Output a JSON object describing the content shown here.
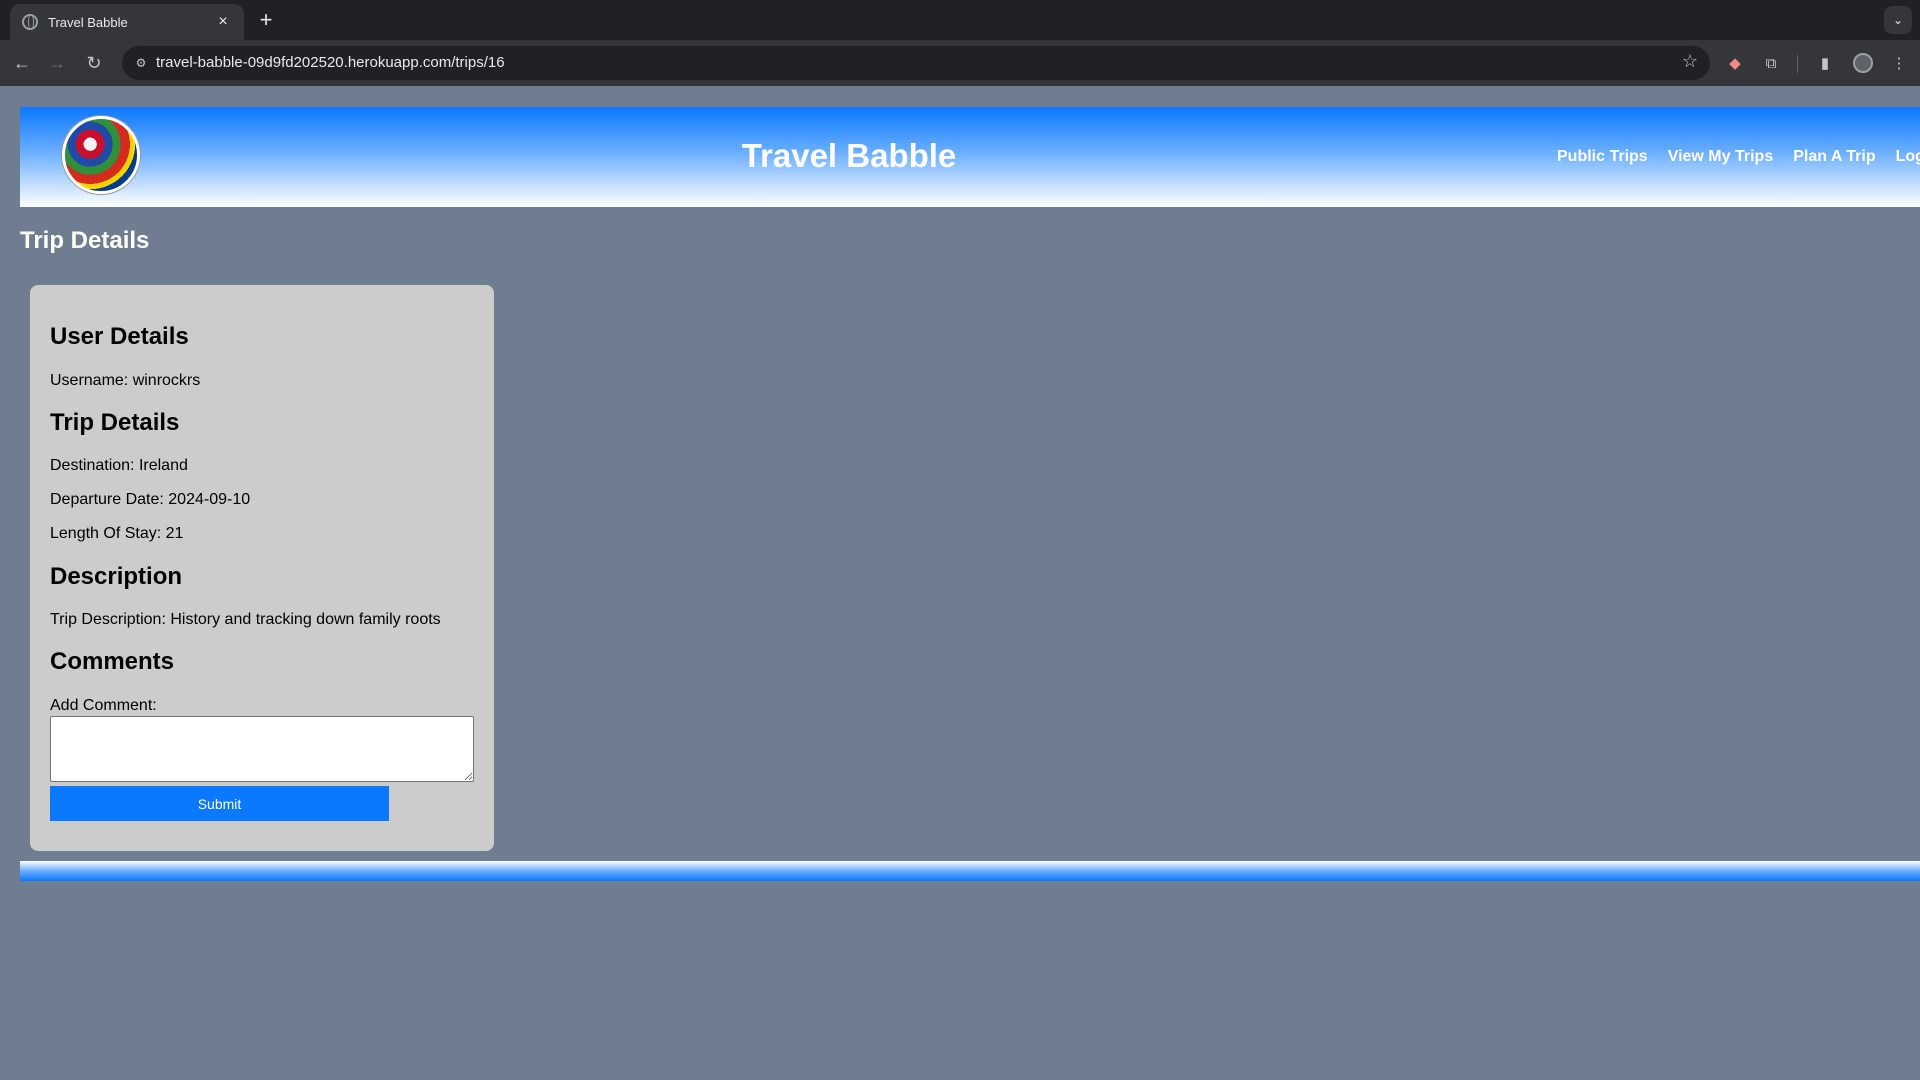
{
  "browser": {
    "tab_title": "Travel Babble",
    "url": "travel-babble-09d9fd202520.herokuapp.com/trips/16"
  },
  "header": {
    "title": "Travel Babble",
    "nav": [
      "Public Trips",
      "View My Trips",
      "Plan A Trip",
      "Log"
    ]
  },
  "page": {
    "title": "Trip Details"
  },
  "card": {
    "user_heading": "User Details",
    "username": "Username: winrockrs",
    "trip_heading": "Trip Details",
    "destination": "Destination: Ireland",
    "departure": "Departure Date: 2024-09-10",
    "length": "Length Of Stay: 21",
    "description_heading": "Description",
    "description": "Trip Description: History and tracking down family roots",
    "comments_heading": "Comments",
    "add_comment_label": "Add Comment:",
    "submit_label": "Submit"
  },
  "colors": {
    "page_background": "#6e7e90",
    "header_blue": "#0a78ff",
    "card_background": "#cccccc",
    "button_blue": "#0a78ff"
  }
}
